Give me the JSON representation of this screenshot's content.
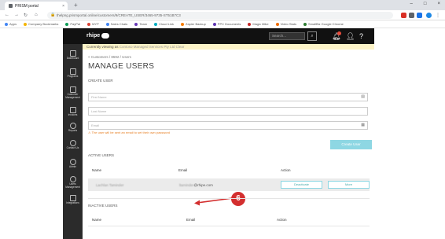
{
  "browser": {
    "tab_title": "PRISM portal",
    "tab_close": "×",
    "new_tab": "+",
    "window_controls": [
      "–",
      "□",
      "×"
    ],
    "url": "thelpng.prismportal.online/customers/9/CREATE_USER/3465-9735-ST51B7C3",
    "bookmarks": [
      "Apps",
      "Company Bookmarks",
      "PayPal",
      "MYP",
      "Sales Chats",
      "Team",
      "Cloud Link",
      "Zapier Backup",
      "PPC Documents",
      "Magic Mike",
      "Video Stats",
      "SmallBiz Google Chrome"
    ]
  },
  "header": {
    "logo": "rhipe",
    "search_placeholder": "Search...",
    "search_icon": "search-icon",
    "icons": [
      "bell-icon",
      "user-icon",
      "help-icon"
    ]
  },
  "sidebar": {
    "items": [
      {
        "label": "Dashboard",
        "icon": "dashboard-icon"
      },
      {
        "label": "Programs",
        "icon": "programs-icon"
      },
      {
        "label": "Customer Management",
        "icon": "customer-icon"
      },
      {
        "label": "Invoices",
        "icon": "invoice-icon"
      },
      {
        "label": "Reports",
        "icon": "reports-icon"
      },
      {
        "label": "Contact Us",
        "icon": "contact-icon"
      },
      {
        "label": "Admin",
        "icon": "admin-icon"
      },
      {
        "label": "Users Management",
        "icon": "users-icon"
      },
      {
        "label": "Integrations",
        "icon": "integrations-icon"
      }
    ]
  },
  "banner": {
    "prefix": "Currently viewing as",
    "company": "Contoso Managed Services Pty Ltd",
    "suffix": "Clear"
  },
  "breadcrumb": "< Customers  /  8592  /  Users",
  "page_title": "MANAGE USERS",
  "create_user": {
    "section_label": "CREATE USER",
    "first_name_placeholder": "First Name",
    "last_name_placeholder": "Last Name",
    "email_placeholder": "Email",
    "warning": "⚠ The user will be sent an email to set their own password",
    "create_button": "Create User"
  },
  "annotation": {
    "number": "6"
  },
  "active_users": {
    "section_label": "ACTIVE USERS",
    "columns": [
      "Name",
      "Email",
      "Action"
    ],
    "rows": [
      {
        "name": "Lachlan Taminder",
        "email": "@rhipe.com",
        "email_blur": "ltaminder",
        "actions": [
          "Deactivate",
          "More"
        ]
      }
    ]
  },
  "inactive_users": {
    "section_label": "INACTIVE USERS",
    "columns": [
      "Name",
      "Email",
      "Action"
    ]
  },
  "colors": {
    "accent": "#8ed7e3",
    "header_bg": "#111111",
    "sidebar_bg": "#2b2b2b",
    "banner_bg": "#fcf3c7",
    "annotation": "#d32f2f"
  }
}
